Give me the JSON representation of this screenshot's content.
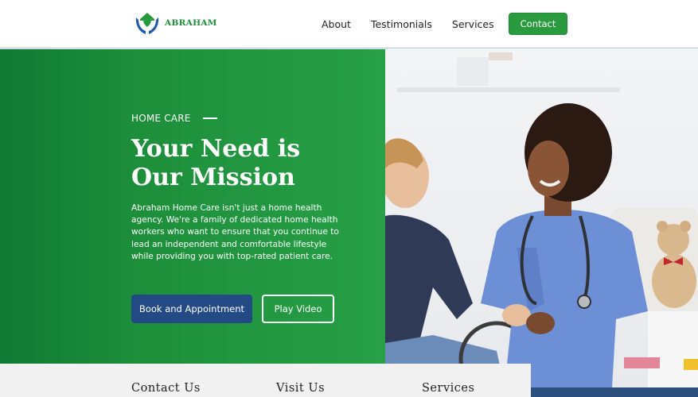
{
  "brand": {
    "name": "ABRAHAM",
    "logo_icon": "hands-heart-house-icon"
  },
  "nav": {
    "items": [
      "About",
      "Testimonials",
      "Services"
    ],
    "contact_label": "Contact"
  },
  "hero": {
    "eyebrow": "HOME CARE",
    "title_line1": "Your Need is",
    "title_line2": "Our Mission",
    "paragraph": "Abraham Home Care isn't just a home health agency. We're a family of dedicated home health workers who want to ensure that you continue to lead an independent and comfortable lifestyle while providing you with top-rated patient care.",
    "book_label": "Book and Appointment",
    "play_label": "Play Video"
  },
  "footer": {
    "headings": [
      "Contact Us",
      "Visit Us",
      "Services"
    ]
  },
  "colors": {
    "brand_green": "#2a9a3f",
    "hero_gradient_start": "#0f7a34",
    "hero_gradient_end": "#27a047",
    "button_blue": "#244a86",
    "scrub_blue": "#6d8fd6"
  }
}
